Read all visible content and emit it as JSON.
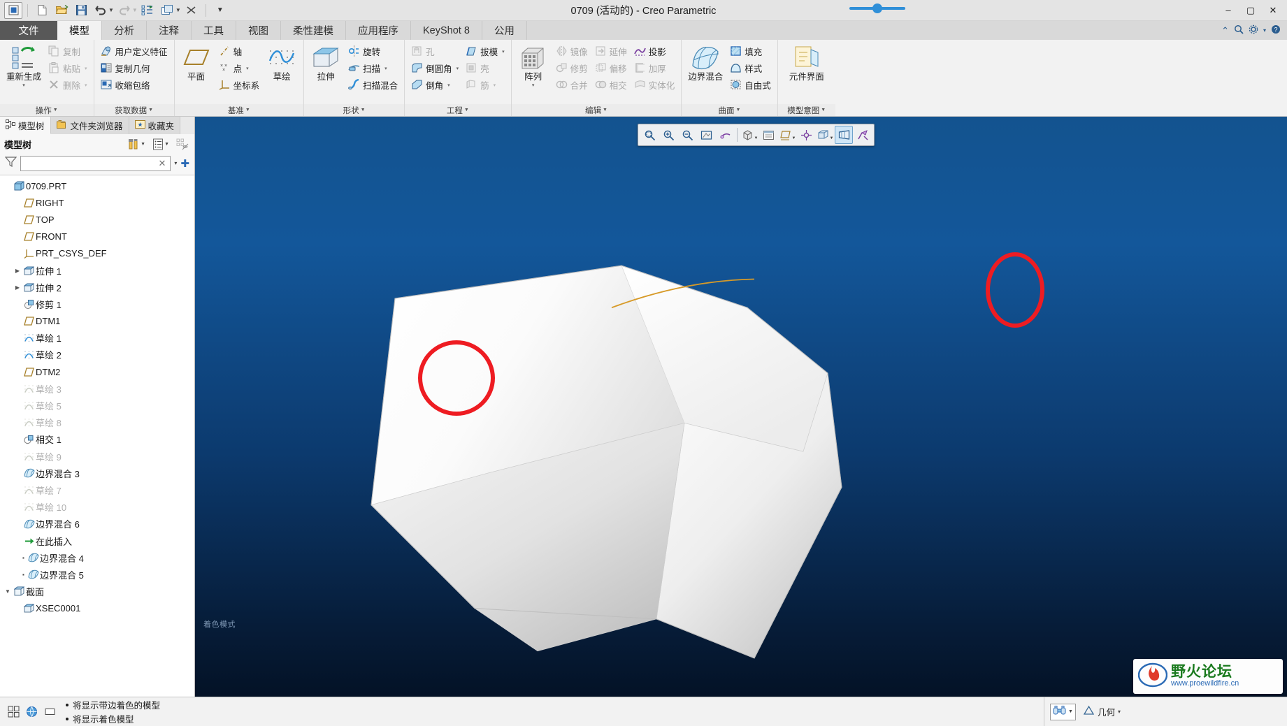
{
  "window": {
    "title": "0709 (活动的) - Creo Parametric",
    "minimize": "–",
    "maximize": "▢",
    "close": "✕"
  },
  "quick_access": [
    {
      "name": "app-menu-icon",
      "glyph": "▣"
    },
    {
      "name": "new-file-icon",
      "glyph": "new"
    },
    {
      "name": "open-file-icon",
      "glyph": "open"
    },
    {
      "name": "save-icon",
      "glyph": "save"
    },
    {
      "name": "undo-icon",
      "glyph": "undo"
    },
    {
      "name": "redo-icon",
      "glyph": "redo"
    },
    {
      "name": "regenerate-icon",
      "glyph": "regen"
    },
    {
      "name": "window-icon",
      "glyph": "window"
    },
    {
      "name": "close-window-icon",
      "glyph": "closewin"
    },
    {
      "name": "customize-qat-icon",
      "glyph": "▾"
    }
  ],
  "tabs": [
    {
      "label": "文件",
      "id": "file",
      "active": false
    },
    {
      "label": "模型",
      "id": "model",
      "active": true
    },
    {
      "label": "分析",
      "id": "analysis",
      "active": false
    },
    {
      "label": "注释",
      "id": "annotate",
      "active": false
    },
    {
      "label": "工具",
      "id": "tools",
      "active": false
    },
    {
      "label": "视图",
      "id": "view",
      "active": false
    },
    {
      "label": "柔性建模",
      "id": "flexible",
      "active": false
    },
    {
      "label": "应用程序",
      "id": "applications",
      "active": false
    },
    {
      "label": "KeyShot 8",
      "id": "keyshot",
      "active": false
    },
    {
      "label": "公用",
      "id": "common",
      "active": false
    }
  ],
  "tabbar_right": {
    "collapse": "⌃",
    "search": "search-icon",
    "options": "gear-icon",
    "options_arrow": "▾",
    "help": "help-icon"
  },
  "ribbon": {
    "groups": [
      {
        "label": "操作",
        "big": {
          "label": "重新生成",
          "arrow": "▾",
          "icon": "regenerate-icon"
        },
        "items": [
          {
            "label": "复制",
            "icon": "copy-icon",
            "disabled": true,
            "arrow": ""
          },
          {
            "label": "粘贴",
            "icon": "paste-icon",
            "disabled": true,
            "arrow": "▾"
          },
          {
            "label": "删除",
            "icon": "delete-icon",
            "disabled": true,
            "arrow": "▾"
          }
        ]
      },
      {
        "label": "获取数据",
        "items": [
          {
            "label": "用户定义特征",
            "icon": "udf-icon",
            "disabled": false,
            "arrow": ""
          },
          {
            "label": "复制几何",
            "icon": "copy-geom-icon",
            "disabled": false,
            "arrow": ""
          },
          {
            "label": "收缩包络",
            "icon": "shrinkwrap-icon",
            "disabled": false,
            "arrow": ""
          }
        ]
      },
      {
        "label": "基准",
        "big": {
          "label": "平面",
          "arrow": "",
          "icon": "datum-plane-icon"
        },
        "items": [
          {
            "label": "轴",
            "icon": "datum-axis-icon",
            "disabled": false,
            "arrow": ""
          },
          {
            "label": "点",
            "icon": "datum-point-icon",
            "disabled": false,
            "arrow": "▾"
          },
          {
            "label": "坐标系",
            "icon": "coord-sys-icon",
            "disabled": false,
            "arrow": ""
          }
        ],
        "big2": {
          "label": "草绘",
          "arrow": "",
          "icon": "sketch-icon"
        }
      },
      {
        "label": "形状",
        "big": {
          "label": "拉伸",
          "arrow": "",
          "icon": "extrude-icon"
        },
        "items": [
          {
            "label": "旋转",
            "icon": "revolve-icon",
            "disabled": false,
            "arrow": ""
          },
          {
            "label": "扫描",
            "icon": "sweep-icon",
            "disabled": false,
            "arrow": "▾"
          },
          {
            "label": "扫描混合",
            "icon": "swept-blend-icon",
            "disabled": false,
            "arrow": ""
          }
        ]
      },
      {
        "label": "工程",
        "items": [
          {
            "label": "孔",
            "icon": "hole-icon",
            "disabled": true,
            "arrow": ""
          },
          {
            "label": "倒圆角",
            "icon": "round-icon",
            "disabled": false,
            "arrow": "▾"
          },
          {
            "label": "倒角",
            "icon": "chamfer-icon",
            "disabled": false,
            "arrow": "▾"
          }
        ],
        "items2": [
          {
            "label": "拔模",
            "icon": "draft-icon",
            "disabled": false,
            "arrow": "▾"
          },
          {
            "label": "壳",
            "icon": "shell-icon",
            "disabled": true,
            "arrow": ""
          },
          {
            "label": "筋",
            "icon": "rib-icon",
            "disabled": true,
            "arrow": "▾"
          }
        ]
      },
      {
        "label": "编辑",
        "big": {
          "label": "阵列",
          "arrow": "▾",
          "icon": "pattern-icon"
        },
        "items": [
          {
            "label": "镜像",
            "icon": "mirror-icon",
            "disabled": true,
            "arrow": ""
          },
          {
            "label": "修剪",
            "icon": "trim-icon",
            "disabled": true,
            "arrow": ""
          },
          {
            "label": "合并",
            "icon": "merge-icon",
            "disabled": true,
            "arrow": ""
          }
        ],
        "items2": [
          {
            "label": "延伸",
            "icon": "extend-icon",
            "disabled": true,
            "arrow": ""
          },
          {
            "label": "偏移",
            "icon": "offset-icon",
            "disabled": true,
            "arrow": ""
          },
          {
            "label": "相交",
            "icon": "intersect-icon",
            "disabled": true,
            "arrow": ""
          }
        ],
        "items3": [
          {
            "label": "投影",
            "icon": "project-icon",
            "disabled": false,
            "arrow": ""
          },
          {
            "label": "加厚",
            "icon": "thicken-icon",
            "disabled": true,
            "arrow": ""
          },
          {
            "label": "实体化",
            "icon": "solidify-icon",
            "disabled": true,
            "arrow": ""
          }
        ]
      },
      {
        "label": "曲面",
        "big": {
          "label": "边界混合",
          "arrow": "",
          "icon": "boundary-blend-icon"
        },
        "items": [
          {
            "label": "填充",
            "icon": "fill-icon",
            "disabled": false,
            "arrow": ""
          },
          {
            "label": "样式",
            "icon": "style-icon",
            "disabled": false,
            "arrow": ""
          },
          {
            "label": "自由式",
            "icon": "freestyle-icon",
            "disabled": false,
            "arrow": ""
          }
        ]
      },
      {
        "label": "模型意图",
        "big": {
          "label": "元件界面",
          "arrow": "",
          "icon": "component-interface-icon"
        }
      }
    ]
  },
  "left_panel": {
    "tabs": [
      {
        "label": "模型树",
        "icon": "model-tree-icon",
        "active": true
      },
      {
        "label": "文件夹浏览器",
        "icon": "folder-browser-icon",
        "active": false
      },
      {
        "label": "收藏夹",
        "icon": "favorites-icon",
        "active": false
      }
    ],
    "title": "模型树",
    "title_buttons": [
      {
        "name": "tools-icon",
        "arrow": "▾"
      },
      {
        "name": "settings-list-icon",
        "arrow": "▾"
      },
      {
        "name": "hide-tree-icon",
        "arrow": ""
      }
    ],
    "filter": {
      "icon": "filter-icon",
      "value": "",
      "placeholder": "",
      "clear": "✕",
      "arrow": "▾",
      "add": "✚"
    },
    "tree": [
      {
        "label": "0709.PRT",
        "icon": "part-icon",
        "indent": 0,
        "expander": "",
        "dim": false
      },
      {
        "label": "RIGHT",
        "icon": "datum-plane-icon",
        "indent": 1,
        "expander": "",
        "dim": false
      },
      {
        "label": "TOP",
        "icon": "datum-plane-icon",
        "indent": 1,
        "expander": "",
        "dim": false
      },
      {
        "label": "FRONT",
        "icon": "datum-plane-icon",
        "indent": 1,
        "expander": "",
        "dim": false
      },
      {
        "label": "PRT_CSYS_DEF",
        "icon": "coord-sys-icon",
        "indent": 1,
        "expander": "",
        "dim": false
      },
      {
        "label": "拉伸 1",
        "icon": "extrude-feature-icon",
        "indent": 1,
        "expander": "▶",
        "dim": false
      },
      {
        "label": "拉伸 2",
        "icon": "extrude-feature-icon",
        "indent": 1,
        "expander": "▶",
        "dim": false
      },
      {
        "label": "修剪 1",
        "icon": "trim-feature-icon",
        "indent": 1,
        "expander": "",
        "dim": false
      },
      {
        "label": "DTM1",
        "icon": "datum-plane-icon",
        "indent": 1,
        "expander": "",
        "dim": false
      },
      {
        "label": "草绘 1",
        "icon": "sketch-feature-icon",
        "indent": 1,
        "expander": "",
        "dim": false
      },
      {
        "label": "草绘 2",
        "icon": "sketch-feature-icon",
        "indent": 1,
        "expander": "",
        "dim": false
      },
      {
        "label": "DTM2",
        "icon": "datum-plane-icon",
        "indent": 1,
        "expander": "",
        "dim": false
      },
      {
        "label": "草绘 3",
        "icon": "sketch-feature-icon",
        "indent": 1,
        "expander": "",
        "dim": true
      },
      {
        "label": "草绘 5",
        "icon": "sketch-feature-icon",
        "indent": 1,
        "expander": "",
        "dim": true
      },
      {
        "label": "草绘 8",
        "icon": "sketch-feature-icon",
        "indent": 1,
        "expander": "",
        "dim": true
      },
      {
        "label": "相交 1",
        "icon": "intersect-feature-icon",
        "indent": 1,
        "expander": "",
        "dim": false
      },
      {
        "label": "草绘 9",
        "icon": "sketch-feature-icon",
        "indent": 1,
        "expander": "",
        "dim": true
      },
      {
        "label": "边界混合 3",
        "icon": "boundary-blend-feature-icon",
        "indent": 1,
        "expander": "",
        "dim": false
      },
      {
        "label": "草绘 7",
        "icon": "sketch-feature-icon",
        "indent": 1,
        "expander": "",
        "dim": true
      },
      {
        "label": "草绘 10",
        "icon": "sketch-feature-icon",
        "indent": 1,
        "expander": "",
        "dim": true
      },
      {
        "label": "边界混合 6",
        "icon": "boundary-blend-feature-icon",
        "indent": 1,
        "expander": "",
        "dim": false
      },
      {
        "label": "在此插入",
        "icon": "insert-here-icon",
        "indent": 1,
        "expander": "",
        "dim": false
      },
      {
        "label": "边界混合 4",
        "icon": "boundary-blend-feature-icon",
        "indent": 1,
        "expander": "",
        "dim": false,
        "marker": "▪"
      },
      {
        "label": "边界混合 5",
        "icon": "boundary-blend-feature-icon",
        "indent": 1,
        "expander": "",
        "dim": false,
        "marker": "▪"
      },
      {
        "label": "截面",
        "icon": "section-icon",
        "indent": 0,
        "expander": "▼",
        "dim": false
      },
      {
        "label": "XSEC0001",
        "icon": "xsec-icon",
        "indent": 1,
        "expander": "",
        "dim": false
      }
    ]
  },
  "viewport": {
    "mode_text": "着色模式",
    "toolbar": [
      {
        "name": "zoom-box-icon",
        "arrow": "",
        "selected": false
      },
      {
        "name": "zoom-in-icon",
        "arrow": "",
        "selected": false
      },
      {
        "name": "zoom-out-icon",
        "arrow": "",
        "selected": false
      },
      {
        "name": "refit-icon",
        "arrow": "",
        "selected": false
      },
      {
        "name": "repaint-icon",
        "arrow": "",
        "selected": false
      },
      {
        "name": "saved-views-icon",
        "arrow": "▾",
        "selected": false
      },
      {
        "name": "view-manager-icon",
        "arrow": "",
        "selected": false
      },
      {
        "name": "datum-display-icon",
        "arrow": "▾",
        "selected": false
      },
      {
        "name": "spin-center-icon",
        "arrow": "",
        "selected": false
      },
      {
        "name": "display-style-icon",
        "arrow": "▾",
        "selected": false
      },
      {
        "name": "perspective-icon",
        "arrow": "",
        "selected": true
      },
      {
        "name": "annotation-display-icon",
        "arrow": "",
        "selected": false
      }
    ],
    "annotations": [
      {
        "name": "red-circle-annotation-left",
        "shape": "circle"
      },
      {
        "name": "red-circle-annotation-right",
        "shape": "circle"
      }
    ]
  },
  "watermark": {
    "top": "野火论坛",
    "bottom": "www.proewildfire.cn",
    "icon": "flame-logo-icon"
  },
  "statusbar": {
    "icons": [
      {
        "name": "select-items-icon"
      },
      {
        "name": "globe-icon"
      },
      {
        "name": "layer-icon"
      }
    ],
    "messages": [
      "将显示带边着色的模型",
      "将显示着色模型"
    ],
    "filter_combo": {
      "icon": "binoculars-icon",
      "arrow": "▾"
    },
    "geometry_label": "几何",
    "geometry_arrow": "▾",
    "geometry_icon": "geometry-filter-icon"
  },
  "colors": {
    "accent": "#2a5d8f",
    "annotation_red": "#ee1c22",
    "ribbon_bg": "#f2f2f2",
    "titlebar_bg": "#e4e4e4",
    "viewport_top": "#13579a",
    "viewport_bottom": "#041226",
    "file_tab_bg": "#585858"
  }
}
